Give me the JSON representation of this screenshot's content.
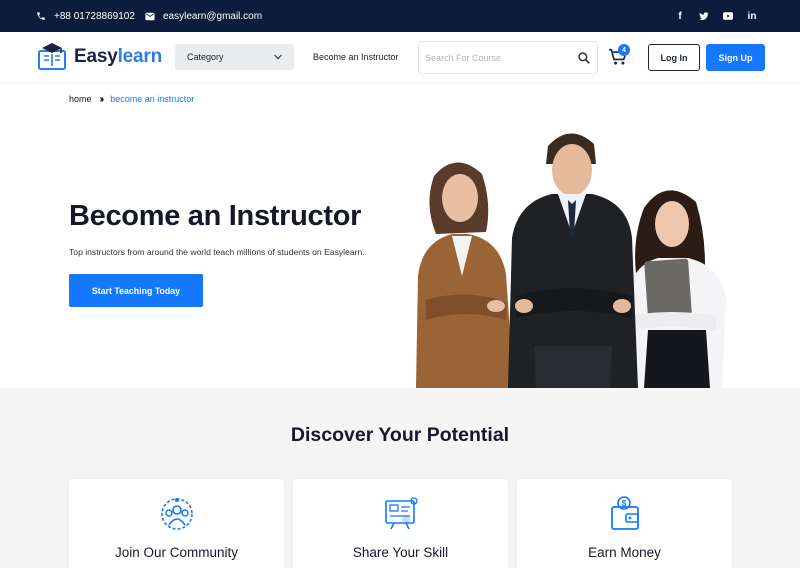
{
  "topbar": {
    "phone": "+88 01728869102",
    "email": "easylearn@gmail.com",
    "phone_icon": "phone-icon",
    "email_icon": "mail-icon",
    "socials": [
      {
        "icon": "facebook-icon",
        "glyph": "f"
      },
      {
        "icon": "twitter-icon",
        "glyph": "t"
      },
      {
        "icon": "youtube-icon",
        "glyph": "▶"
      },
      {
        "icon": "linkedin-icon",
        "glyph": "in"
      }
    ]
  },
  "header": {
    "logo_part1": "Easy",
    "logo_part2": "learn",
    "category_label": "Category",
    "nav_link": "Become an Instructor",
    "search_placeholder": "Search For Course",
    "cart_count": "4",
    "login_label": "Log In",
    "signup_label": "Sign Up"
  },
  "breadcrumb": {
    "home": "home",
    "current": "become an instructor"
  },
  "hero": {
    "title": "Become an Instructor",
    "subtitle": "Top instructors from around the world teach millions of students on Easylearn.",
    "button_label": "Start Teaching Today"
  },
  "discover": {
    "title": "Discover Your Potential",
    "cards": [
      {
        "label": "Join Our Community",
        "icon": "community-icon"
      },
      {
        "label": "Share Your Skill",
        "icon": "share-skill-icon"
      },
      {
        "label": "Earn Money",
        "icon": "wallet-icon"
      }
    ]
  },
  "colors": {
    "topbar_bg": "#0b1d3a",
    "accent": "#1677ff",
    "logo_dark": "#1b2340",
    "section_bg": "#f5f5f5"
  }
}
